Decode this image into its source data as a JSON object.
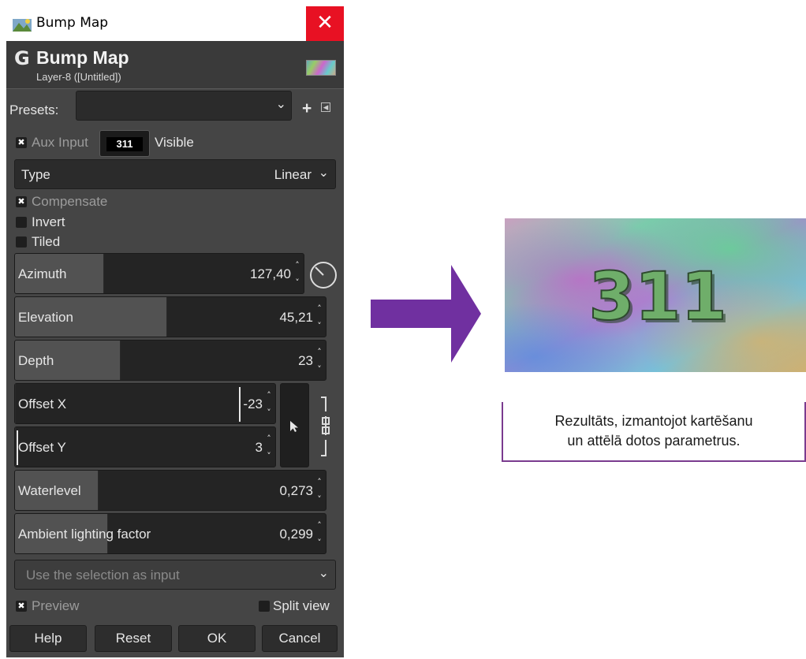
{
  "window": {
    "title": "Bump Map",
    "close_glyph": "✕",
    "app_icon": "gimp-image-icon"
  },
  "header": {
    "logo_glyph": "G",
    "title": "Bump Map",
    "subtitle": "Layer-8 ([Untitled])"
  },
  "presets": {
    "label": "Presets:",
    "value": "",
    "add_glyph": "+",
    "menu_glyph": "◂"
  },
  "aux_input": {
    "checked": true,
    "label": "Aux Input",
    "thumb_text": "311",
    "visible_label": "Visible"
  },
  "type_combo": {
    "label": "Type",
    "value": "Linear"
  },
  "options": {
    "compensate": {
      "label": "Compensate",
      "checked": true
    },
    "invert": {
      "label": "Invert",
      "checked": false
    },
    "tiled": {
      "label": "Tiled",
      "checked": false
    }
  },
  "sliders": {
    "azimuth": {
      "label": "Azimuth",
      "value": "127,40",
      "fill": 0.31
    },
    "elevation": {
      "label": "Elevation",
      "value": "45,21",
      "fill": 0.49
    },
    "depth": {
      "label": "Depth",
      "value": "23",
      "fill": 0.34
    },
    "offset_x": {
      "label": "Offset X",
      "value": "-23",
      "fill": 0.0
    },
    "offset_y": {
      "label": "Offset Y",
      "value": "3",
      "fill": 0.0
    },
    "waterlevel": {
      "label": "Waterlevel",
      "value": "0,273",
      "fill": 0.27
    },
    "ambient": {
      "label": "Ambient lighting factor",
      "value": "0,299",
      "fill": 0.3
    }
  },
  "selection_combo": {
    "value": "Use the selection as input"
  },
  "preview": {
    "label": "Preview",
    "checked": true
  },
  "split_view": {
    "label": "Split view",
    "checked": false
  },
  "buttons": {
    "help": "Help",
    "reset": "Reset",
    "ok": "OK",
    "cancel": "Cancel"
  },
  "result": {
    "image_text": "311",
    "caption_line1": "Rezultāts, izmantojot kartēšanu",
    "caption_line2": "un attēlā dotos parametrus."
  },
  "colors": {
    "arrow": "#7030a0",
    "close": "#e81123",
    "dialog_bg": "#454545"
  }
}
